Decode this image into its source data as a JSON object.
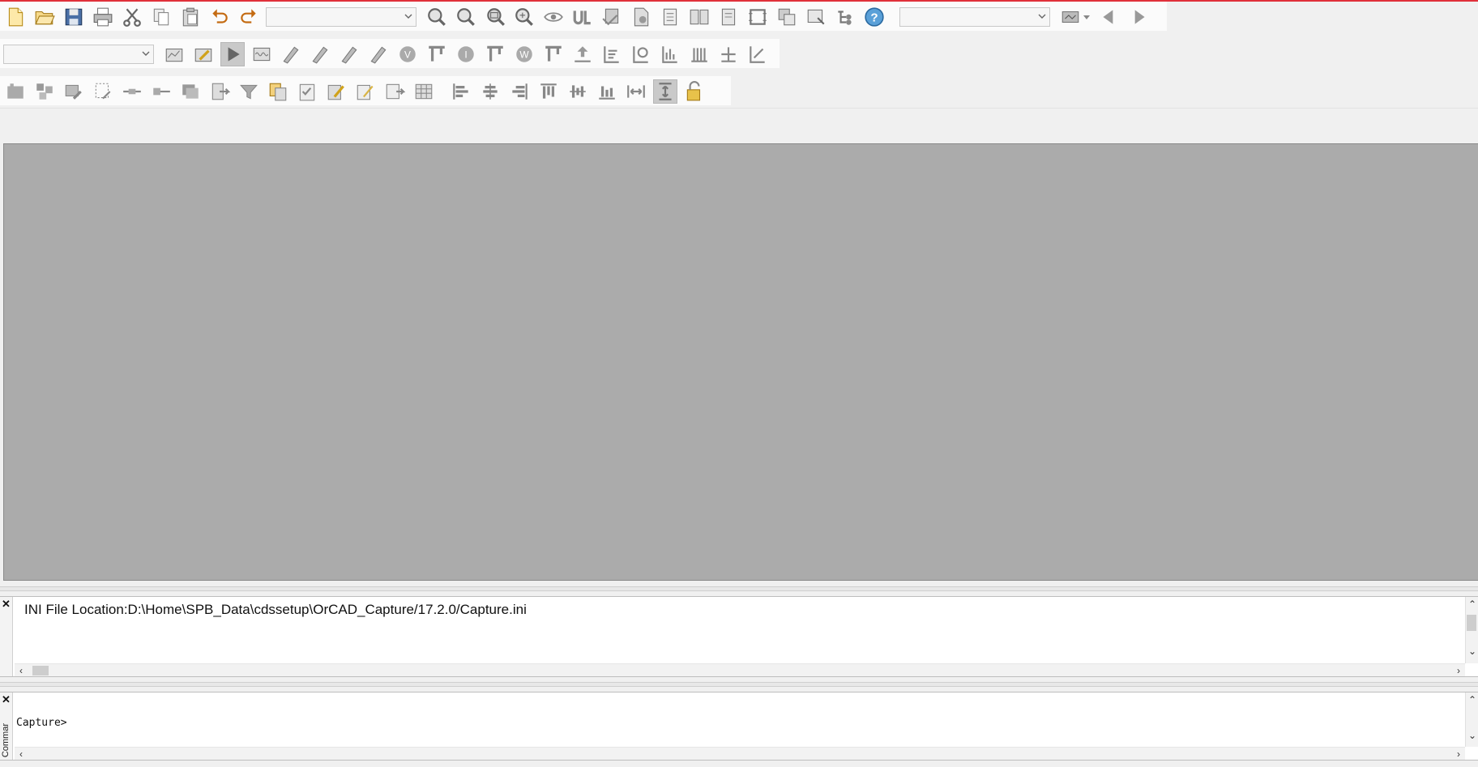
{
  "window": {
    "accent_color": "#e0303a"
  },
  "toolbar1": {
    "combo_part": "",
    "combo_zoom": "",
    "icons": [
      "new-file",
      "open-folder",
      "save",
      "print",
      "cut",
      "copy",
      "paste",
      "undo",
      "redo",
      "zoom-in",
      "zoom-out",
      "zoom-area",
      "zoom-all",
      "view",
      "ul",
      "place-part",
      "place-page",
      "document",
      "two-page",
      "page",
      "fit",
      "snap-grid",
      "area-select",
      "tree",
      "help"
    ]
  },
  "toolbar2": {
    "combo_profile": "",
    "icons": [
      "new-simulation-profile",
      "edit-simulation",
      "run",
      "view-waveform",
      "probe-voltage",
      "probe-current",
      "probe-power",
      "probe-diff",
      "voltage-marker",
      "bias-voltage",
      "current-marker",
      "bias-current",
      "power-marker",
      "bias-power",
      "toggle-bias",
      "marker-a",
      "marker-b",
      "marker-c",
      "bar-chart",
      "column-chart",
      "marker-d",
      "marker-e"
    ]
  },
  "toolbar3": {
    "icons": [
      "library",
      "hierarchy",
      "edit-part",
      "design-rules",
      "net-alias",
      "bus-entry",
      "layers",
      "export",
      "filter",
      "copy-design",
      "checklist",
      "edit",
      "edit-props",
      "next",
      "table",
      "align-left",
      "align-center",
      "align-right",
      "align-top",
      "align-middle",
      "align-bottom",
      "distribute-horizontal",
      "distribute-vertical",
      "lock"
    ]
  },
  "session_log": {
    "message": "INI File Location:D:\\Home\\SPB_Data\\cdssetup\\OrCAD_Capture/17.2.0/Capture.ini"
  },
  "command_window": {
    "prompt": "Capture>",
    "side_label": "Commar"
  }
}
